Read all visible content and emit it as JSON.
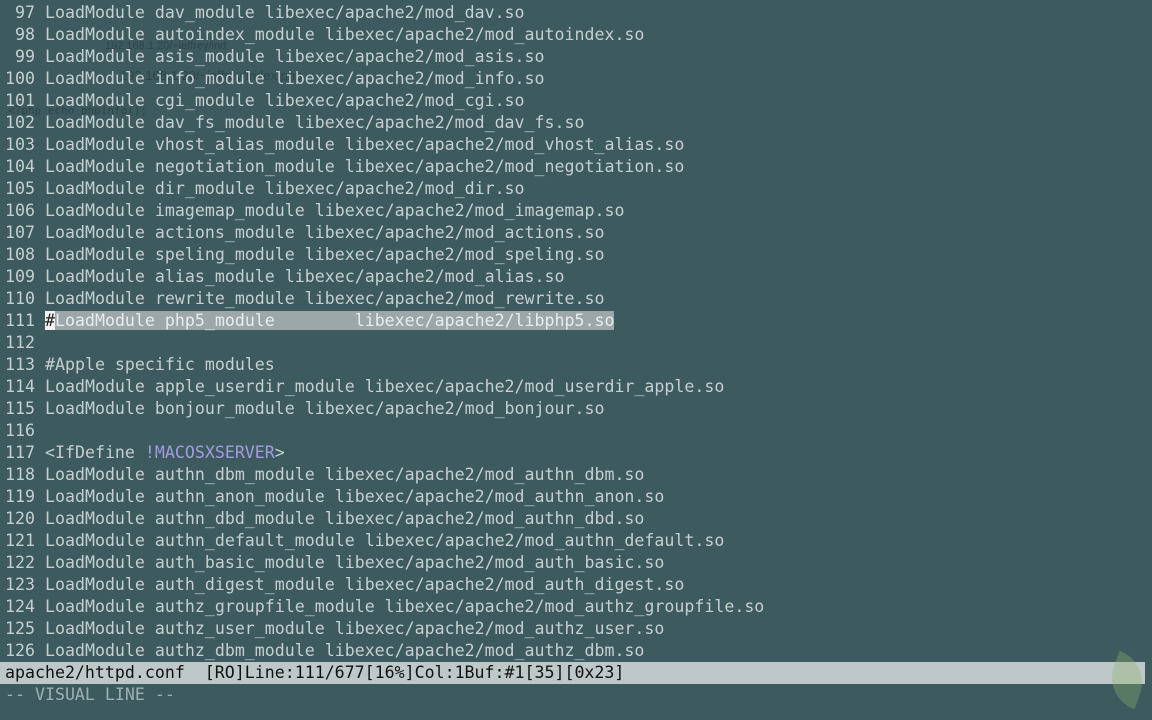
{
  "lines": [
    {
      "n": "97",
      "text": "LoadModule dav_module libexec/apache2/mod_dav.so"
    },
    {
      "n": "98",
      "text": "LoadModule autoindex_module libexec/apache2/mod_autoindex.so"
    },
    {
      "n": "99",
      "text": "LoadModule asis_module libexec/apache2/mod_asis.so"
    },
    {
      "n": "100",
      "text": "LoadModule info_module libexec/apache2/mod_info.so"
    },
    {
      "n": "101",
      "text": "LoadModule cgi_module libexec/apache2/mod_cgi.so"
    },
    {
      "n": "102",
      "text": "LoadModule dav_fs_module libexec/apache2/mod_dav_fs.so"
    },
    {
      "n": "103",
      "text": "LoadModule vhost_alias_module libexec/apache2/mod_vhost_alias.so"
    },
    {
      "n": "104",
      "text": "LoadModule negotiation_module libexec/apache2/mod_negotiation.so"
    },
    {
      "n": "105",
      "text": "LoadModule dir_module libexec/apache2/mod_dir.so"
    },
    {
      "n": "106",
      "text": "LoadModule imagemap_module libexec/apache2/mod_imagemap.so"
    },
    {
      "n": "107",
      "text": "LoadModule actions_module libexec/apache2/mod_actions.so"
    },
    {
      "n": "108",
      "text": "LoadModule speling_module libexec/apache2/mod_speling.so"
    },
    {
      "n": "109",
      "text": "LoadModule alias_module libexec/apache2/mod_alias.so"
    },
    {
      "n": "110",
      "text": "LoadModule rewrite_module libexec/apache2/mod_rewrite.so"
    },
    {
      "n": "111",
      "cursor": "#",
      "text": "LoadModule php5_module        libexec/apache2/libphp5.so",
      "selected": true
    },
    {
      "n": "112",
      "text": ""
    },
    {
      "n": "113",
      "text": "#Apple specific modules"
    },
    {
      "n": "114",
      "text": "LoadModule apple_userdir_module libexec/apache2/mod_userdir_apple.so"
    },
    {
      "n": "115",
      "text": "LoadModule bonjour_module libexec/apache2/mod_bonjour.so"
    },
    {
      "n": "116",
      "text": ""
    },
    {
      "n": "117",
      "pre": "<IfDefine ",
      "kw": "!MACOSXSERVER",
      "post": ">"
    },
    {
      "n": "118",
      "text": "LoadModule authn_dbm_module libexec/apache2/mod_authn_dbm.so"
    },
    {
      "n": "119",
      "text": "LoadModule authn_anon_module libexec/apache2/mod_authn_anon.so"
    },
    {
      "n": "120",
      "text": "LoadModule authn_dbd_module libexec/apache2/mod_authn_dbd.so"
    },
    {
      "n": "121",
      "text": "LoadModule authn_default_module libexec/apache2/mod_authn_default.so"
    },
    {
      "n": "122",
      "text": "LoadModule auth_basic_module libexec/apache2/mod_auth_basic.so"
    },
    {
      "n": "123",
      "text": "LoadModule auth_digest_module libexec/apache2/mod_auth_digest.so"
    },
    {
      "n": "124",
      "text": "LoadModule authz_groupfile_module libexec/apache2/mod_authz_groupfile.so"
    },
    {
      "n": "125",
      "text": "LoadModule authz_user_module libexec/apache2/mod_authz_user.so"
    },
    {
      "n": "126",
      "text": "LoadModule authz_dbm_module libexec/apache2/mod_authz_dbm.so"
    }
  ],
  "status": "apache2/httpd.conf  [RO]Line:111/677[16%]Col:1Buf:#1[35][0x23]",
  "mode": "-- VISUAL LINE --",
  "ghost": {
    "url1": "192.168.1.20/~jeffrey/ind",
    "url2": "192.168.1.20/~jeffrey/index.php",
    "code": "<?php echo phpinfo();"
  }
}
